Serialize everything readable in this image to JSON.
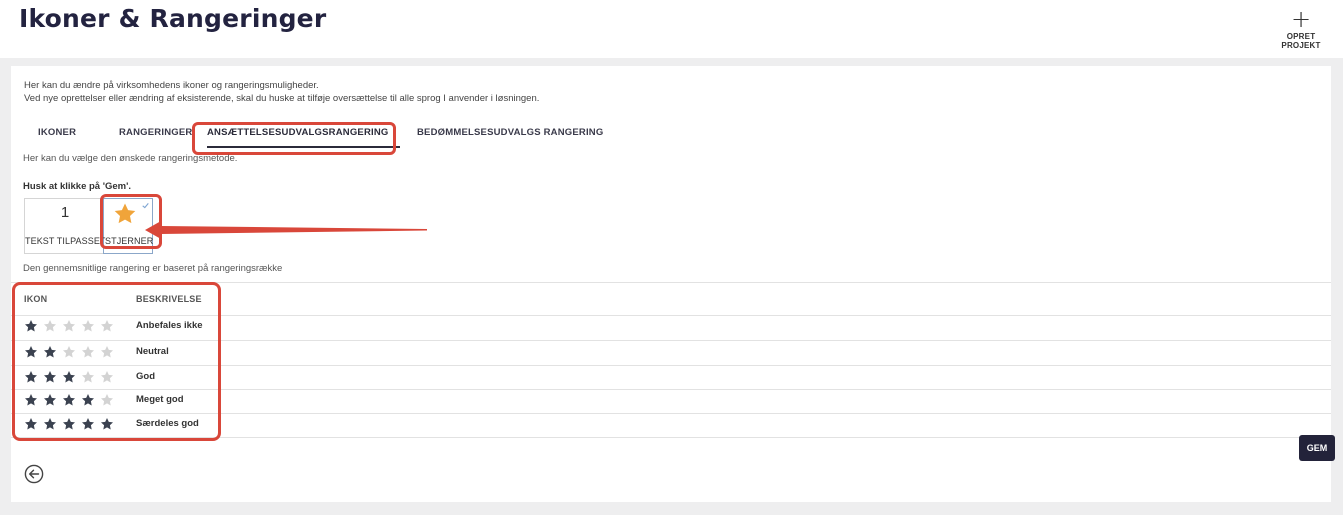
{
  "header": {
    "title": "Ikoner & Rangeringer",
    "create_label": "OPRET PROJEKT"
  },
  "intro": {
    "line1": "Her kan du ændre på virksomhedens ikoner og rangeringsmuligheder.",
    "line2": "Ved nye oprettelser eller ændring af eksisterende, skal du huske at tilføje oversættelse til alle sprog I anvender i løsningen."
  },
  "tabs": [
    {
      "label": "IKONER"
    },
    {
      "label": "RANGERINGER"
    },
    {
      "label": "ANSÆTTELSESUDVALGSRANGERING"
    },
    {
      "label": "BEDØMMELSESUDVALGS RANGERING"
    }
  ],
  "active_tab": "ANSÆTTELSESUDVALGSRANGERING",
  "help_text": "Her kan du vælge den ønskede rangeringsmetode.",
  "remember_text": "Husk at klikke på 'Gem'.",
  "options": {
    "text_number": "1",
    "text_label": "TEKST TILPASSET",
    "stars_label": "STJERNER",
    "selected": "STJERNER"
  },
  "avg_note": "Den gennemsnitlige rangering er baseret på rangeringsrække",
  "table": {
    "col_icon": "IKON",
    "col_desc": "BESKRIVELSE",
    "max_stars": 5,
    "rows": [
      {
        "stars": 1,
        "desc": "Anbefales ikke"
      },
      {
        "stars": 2,
        "desc": "Neutral"
      },
      {
        "stars": 3,
        "desc": "God"
      },
      {
        "stars": 4,
        "desc": "Meget god"
      },
      {
        "stars": 5,
        "desc": "Særdeles god"
      }
    ]
  },
  "save_label": "GEM",
  "colors": {
    "accent": "#23233a",
    "highlight": "#d9473a",
    "star_gold": "#f0a43a",
    "star_filled": "#3b4250",
    "star_empty": "#d3d3d3"
  }
}
